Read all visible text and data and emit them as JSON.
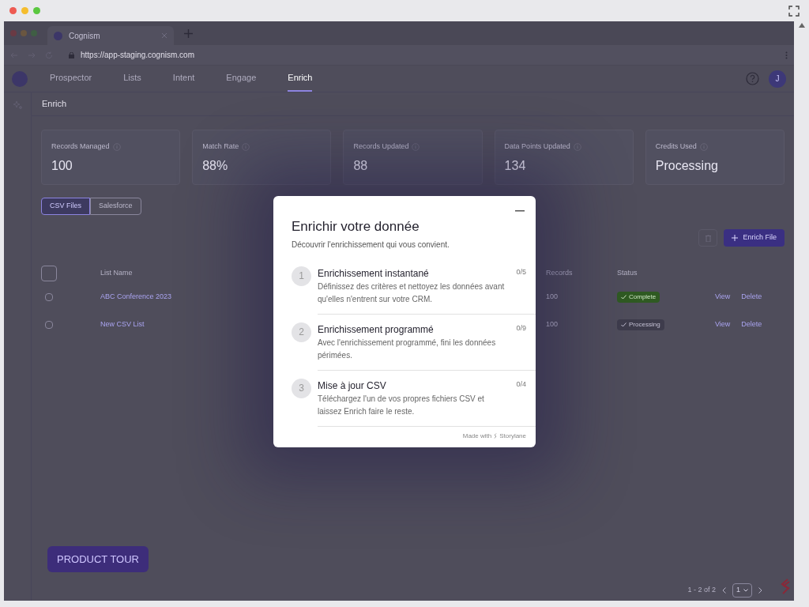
{
  "browser": {
    "tab_title": "Cognism",
    "url": "https://app-staging.cognism.com"
  },
  "nav": {
    "items": [
      {
        "label": "Prospector",
        "selected": false
      },
      {
        "label": "Lists",
        "selected": false
      },
      {
        "label": "Intent",
        "selected": false
      },
      {
        "label": "Engage",
        "selected": false
      },
      {
        "label": "Enrich",
        "selected": true
      }
    ],
    "avatar": "J"
  },
  "page_title": "Enrich",
  "stats": [
    {
      "label": "Records Managed",
      "value": "100"
    },
    {
      "label": "Match Rate",
      "value": "88%"
    },
    {
      "label": "Records Updated",
      "value": "88"
    },
    {
      "label": "Data Points Updated",
      "value": "134"
    },
    {
      "label": "Credits Used",
      "value": "Processing"
    }
  ],
  "source_tabs": [
    {
      "label": "CSV Files",
      "selected": true
    },
    {
      "label": "Salesforce",
      "selected": false
    }
  ],
  "enrich_button": "Enrich File",
  "table": {
    "columns": [
      "List Name",
      "Records",
      "Status"
    ],
    "select_all_checked": false,
    "rows": [
      {
        "checked": false,
        "name": "ABC Conference 2023",
        "records": "100",
        "status": "Complete",
        "kind": "complete",
        "actions": [
          "View",
          "Delete"
        ]
      },
      {
        "checked": false,
        "name": "New CSV List",
        "records": "100",
        "status": "Processing",
        "kind": "processing",
        "actions": [
          "View",
          "Delete"
        ]
      }
    ]
  },
  "pagination": {
    "range": "1 - 2 of 2",
    "page": "1"
  },
  "product_tour": "PRODUCT TOUR",
  "modal": {
    "title": "Enrichir votre donnée",
    "subtitle": "Découvrir l'enrichissement qui vous convient.",
    "steps": [
      {
        "number": "1",
        "title": "Enrichissement instantané",
        "description": "Définissez des critères et nettoyez les données avant qu'elles n'entrent sur votre CRM.",
        "progress": "0/5"
      },
      {
        "number": "2",
        "title": "Enrichissement programmé",
        "description": "Avec l'enrichissement programmé, fini les données périmées.",
        "progress": "0/9"
      },
      {
        "number": "3",
        "title": "Mise à jour CSV",
        "description": "Téléchargez l'un de vos propres fichiers CSV et laissez Enrich faire le reste.",
        "progress": "0/4"
      }
    ],
    "footer": "Made with",
    "brand": "Storylane"
  }
}
